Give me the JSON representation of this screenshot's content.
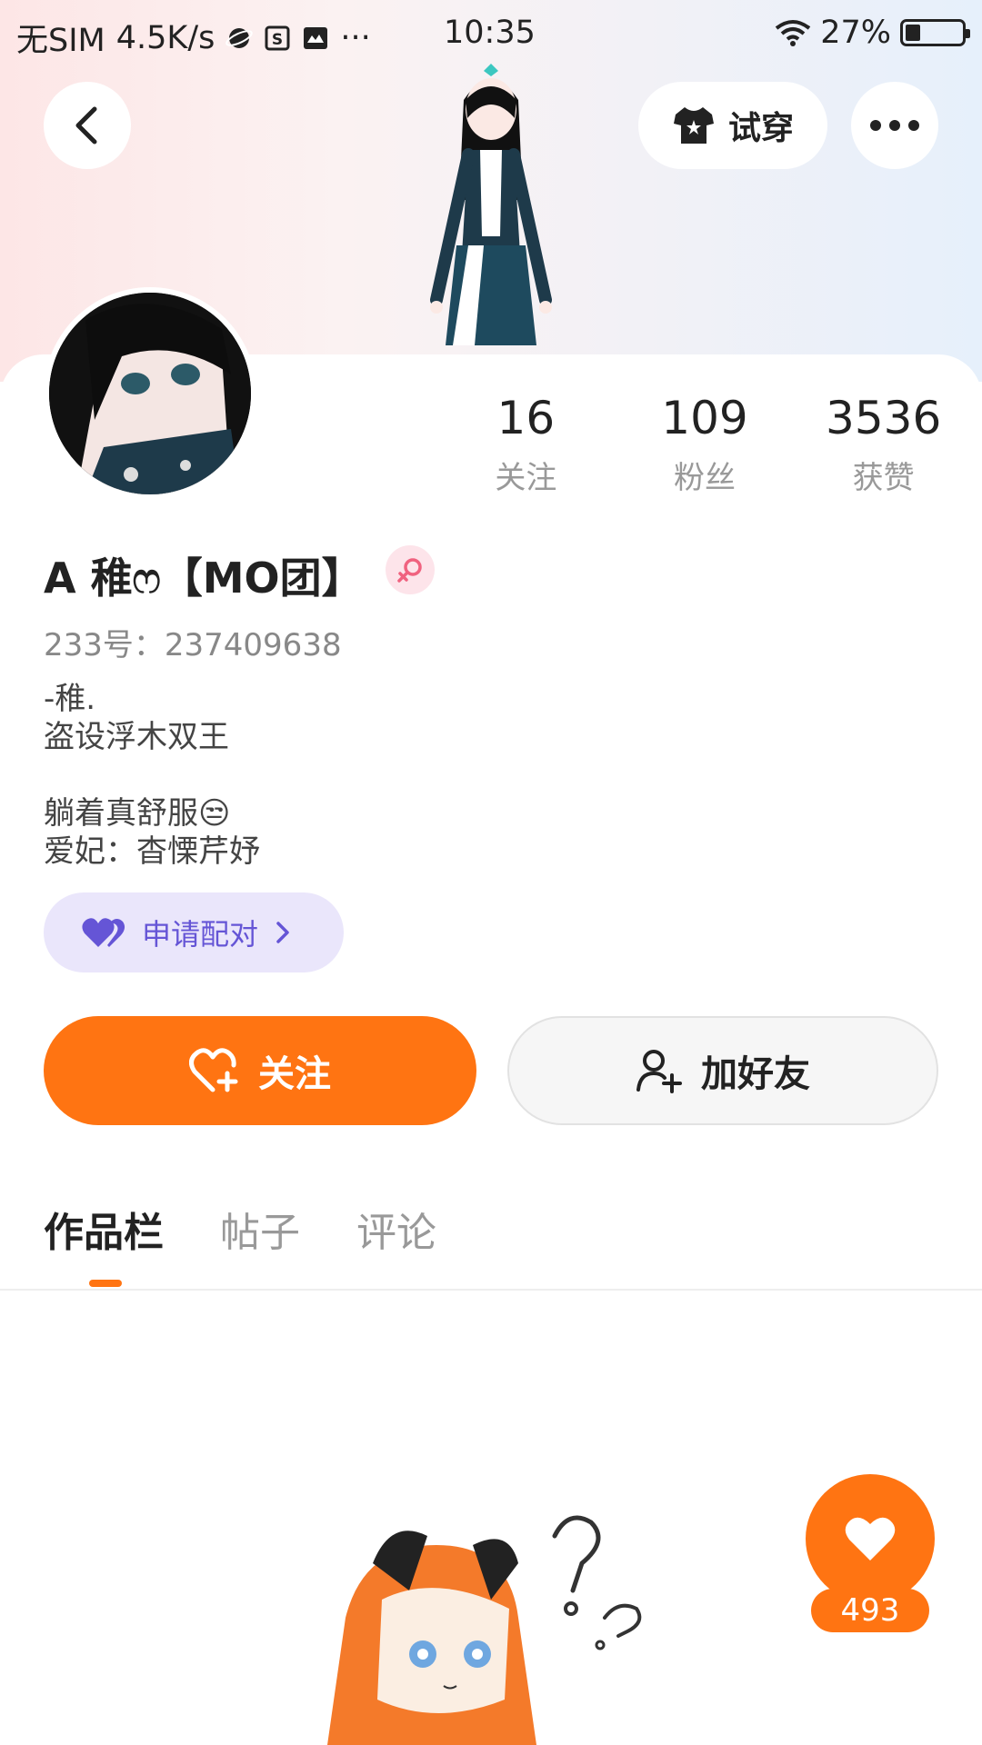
{
  "status_bar": {
    "carrier": "无SIM",
    "speed": "4.5K/s",
    "time": "10:35",
    "battery": "27%",
    "battery_level": 0.27
  },
  "header": {
    "back_icon": "chevron-left-icon",
    "tryon_label": "试穿",
    "more_icon": "more-dots-icon"
  },
  "stats": [
    {
      "value": "16",
      "label": "关注"
    },
    {
      "value": "109",
      "label": "粉丝"
    },
    {
      "value": "3536",
      "label": "获赞"
    }
  ],
  "profile": {
    "username": "A 稚ෆ【MO团】",
    "gender_icon": "female-icon",
    "uid": "233号：237409638",
    "bio_lines": [
      "-稚.",
      "盗设浮木双王",
      "",
      "躺着真舒服😒",
      "爱妃：杳慄芹妤"
    ]
  },
  "pair_button": {
    "label": "申请配对"
  },
  "actions": {
    "follow_label": "关注",
    "add_friend_label": "加好友"
  },
  "tabs": [
    {
      "label": "作品栏",
      "active": true
    },
    {
      "label": "帖子",
      "active": false
    },
    {
      "label": "评论",
      "active": false
    }
  ],
  "like_fab": {
    "count": "493"
  },
  "colors": {
    "accent": "#ff7412",
    "pair_bg": "#eae6fb",
    "pair_text": "#6555d6"
  }
}
